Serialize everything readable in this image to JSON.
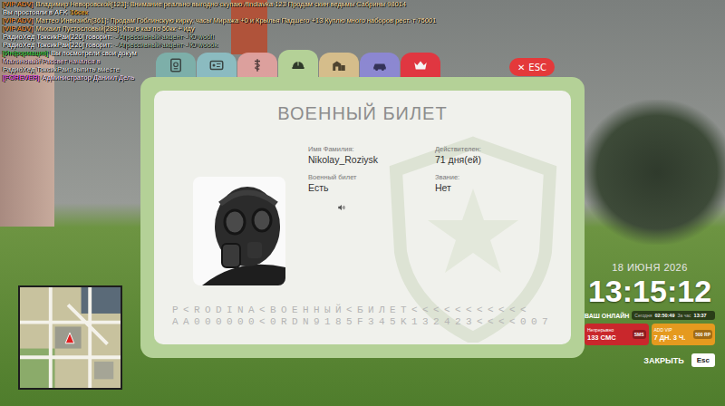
{
  "chat": [
    {
      "segments": [
        {
          "text": "[VIP ADV]",
          "color": "#ff8c1a"
        },
        {
          "text": "Владимир Неворовской[123]: Внимание реально выгодно скупаю /findiavka 123 Продам скин ведьмы Сабрины 98014",
          "color": "#ffe0a8"
        }
      ]
    },
    {
      "segments": [
        {
          "text": "Вы простояли в AFK",
          "color": "#ffffff"
        },
        {
          "text": "16сек",
          "color": "#ffb020"
        }
      ]
    },
    {
      "segments": [
        {
          "text": "[VIP ADV]",
          "color": "#ff8c1a"
        },
        {
          "text": "Маттео Инвизибл[361]: Продам Гоблинскую кирку, часы Миража +0 и Крылья Падшего +13 Куплю много наборов рест. т 75001",
          "color": "#ffe0a8"
        }
      ]
    },
    {
      "segments": [
        {
          "text": "[VIP ADV]",
          "color": "#ff8c1a"
        },
        {
          "text": "Михаил Пустословый[288]: Кто в каз по 50кк + иду",
          "color": "#ffe0a8"
        }
      ]
    },
    {
      "segments": [
        {
          "text": "РадиоХед ТоксикРаи[220] говорит:",
          "color": "#ffffff"
        },
        {
          "text": "- Агрессивный акцент - Ю woof!",
          "color": "#a9c2aa"
        }
      ]
    },
    {
      "segments": [
        {
          "text": "РадиоХед ТоксикРаи[220] говорит:",
          "color": "#ffffff"
        },
        {
          "text": "- Агрессивный акцент - Ю woook",
          "color": "#a9c2aa"
        }
      ]
    },
    {
      "segments": [
        {
          "text": "[Информация]",
          "color": "#3fd43f"
        },
        {
          "text": "Вы посмотрели свои докум",
          "color": "#ffffff"
        }
      ]
    },
    {
      "segments": [
        {
          "text": "Малиновый Рассвет начался в",
          "color": "#f0d0e0"
        }
      ]
    },
    {
      "segments": [
        {
          "text": "РадиоХед ТоксикРаи: выпить вместе",
          "color": "#e8e8e8"
        }
      ]
    },
    {
      "segments": [
        {
          "text": "[FOREVER]",
          "color": "#ff4dff"
        },
        {
          "text": "Администратор Даниил Дель",
          "color": "#ffe0ff"
        }
      ]
    }
  ],
  "tabs": [
    {
      "kind": "passport",
      "color": "#7db3ad",
      "selected": false
    },
    {
      "kind": "id-card",
      "color": "#8cc0c6",
      "selected": false
    },
    {
      "kind": "medical",
      "color": "#e4a3a0",
      "selected": false
    },
    {
      "kind": "military",
      "color": "#b4d197",
      "selected": true
    },
    {
      "kind": "property",
      "color": "#dcc28c",
      "selected": false
    },
    {
      "kind": "vehicle",
      "color": "#8d88d8",
      "selected": false
    },
    {
      "kind": "donate",
      "color": "#e8313c",
      "selected": false
    }
  ],
  "close_button": {
    "icon": "✕",
    "label": "ESC"
  },
  "document": {
    "title": "ВОЕННЫЙ БИЛЕТ",
    "fields": [
      {
        "label": "Имя Фамилия:",
        "value": "Nikolay_Roziysk"
      },
      {
        "label": "Действителен:",
        "value": "71 дня(ей)"
      },
      {
        "label": "Военный билет",
        "value": "Есть"
      },
      {
        "label": "Звание:",
        "value": "Нет"
      }
    ],
    "mrz": [
      "P<RODINA<ВОЕННЫЙ<БИЛЕТ<<<<<<<<<<<",
      "AA000000<0RDN9185F345K132423<<<<007"
    ]
  },
  "hud": {
    "date": "18 ИЮНЯ 2026",
    "time": "13:15:12",
    "online": {
      "label": "ВАШ ОНЛАЙН",
      "today_label": "Сегодня",
      "today": "02:50:49",
      "hour_label": "За час",
      "hour": "13:37"
    },
    "promos": [
      {
        "title": "Непрерывно",
        "value": "133 СМС",
        "badge": "SMS",
        "color": "#c9272c"
      },
      {
        "title": "ADD VIP",
        "value": "7 ДН. 3 Ч.",
        "badge": "500 RP",
        "color": "#e59a1f"
      }
    ],
    "close": {
      "label": "ЗАКРЫТЬ",
      "key": "Esc"
    }
  }
}
